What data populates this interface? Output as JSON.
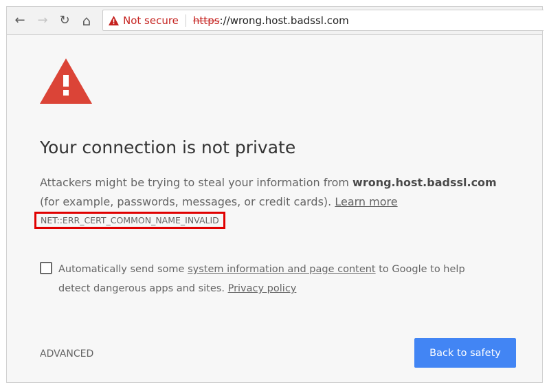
{
  "toolbar": {
    "back_icon": "←",
    "forward_icon": "→",
    "reload_icon": "↻",
    "home_icon": "⌂"
  },
  "omnibox": {
    "security_label": "Not secure",
    "scheme": "https",
    "rest": "://wrong.host.badssl.com"
  },
  "page": {
    "heading": "Your connection is not private",
    "desc_pre": "Attackers might be trying to steal your information from ",
    "desc_host": "wrong.host.badssl.com",
    "desc_post": " (for example, passwords, messages, or credit cards). ",
    "learn_more": "Learn more",
    "error_code": "NET::ERR_CERT_COMMON_NAME_INVALID",
    "checkbox_pre": "Automatically send some ",
    "checkbox_link": "system information and page content",
    "checkbox_post": " to Google to help detect dangerous apps and sites. ",
    "privacy_link": "Privacy policy",
    "checkbox_checked": false,
    "advanced": "ADVANCED",
    "back_to_safety": "Back to safety"
  },
  "colors": {
    "warning_red": "#db4437",
    "button_blue": "#4285f4",
    "highlight_box": "#e00000"
  }
}
